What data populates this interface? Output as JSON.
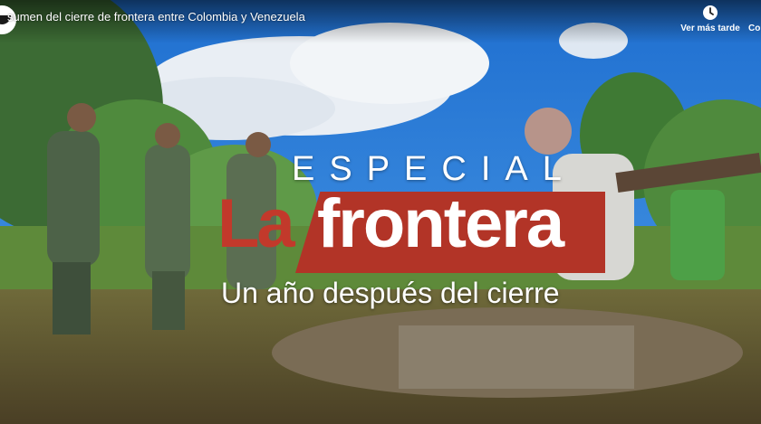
{
  "video": {
    "title": "sumen del cierre de frontera entre Colombia y Venezuela"
  },
  "actions": {
    "watch_later_label": "Ver más tarde",
    "share_label": "Co",
    "watch_later_icon": "clock-icon"
  },
  "overlay": {
    "especial": "ESPECIAL",
    "la": "La",
    "frontera": "frontera",
    "subtitle": "Un año después del cierre"
  },
  "colors": {
    "brand_red": "#b23427",
    "sky": "#2f7fd6"
  }
}
